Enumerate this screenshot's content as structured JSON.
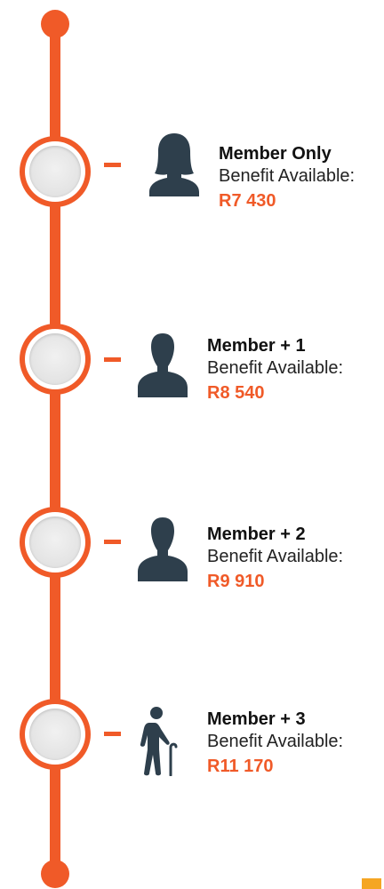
{
  "colors": {
    "accent": "#f05a28",
    "icon": "#2e3f4c",
    "corner_mark": "#f5a623"
  },
  "tiers": [
    {
      "title": "Member Only",
      "subtitle": "Benefit Available:",
      "amount": "R7 430",
      "icon": "woman-silhouette-icon"
    },
    {
      "title": "Member + 1",
      "subtitle": "Benefit Available:",
      "amount": "R8 540",
      "icon": "man-silhouette-icon"
    },
    {
      "title": "Member + 2",
      "subtitle": "Benefit Available:",
      "amount": "R9 910",
      "icon": "man-silhouette-icon"
    },
    {
      "title": "Member + 3",
      "subtitle": "Benefit Available:",
      "amount": "R11 170",
      "icon": "elderly-person-with-cane-icon"
    }
  ]
}
